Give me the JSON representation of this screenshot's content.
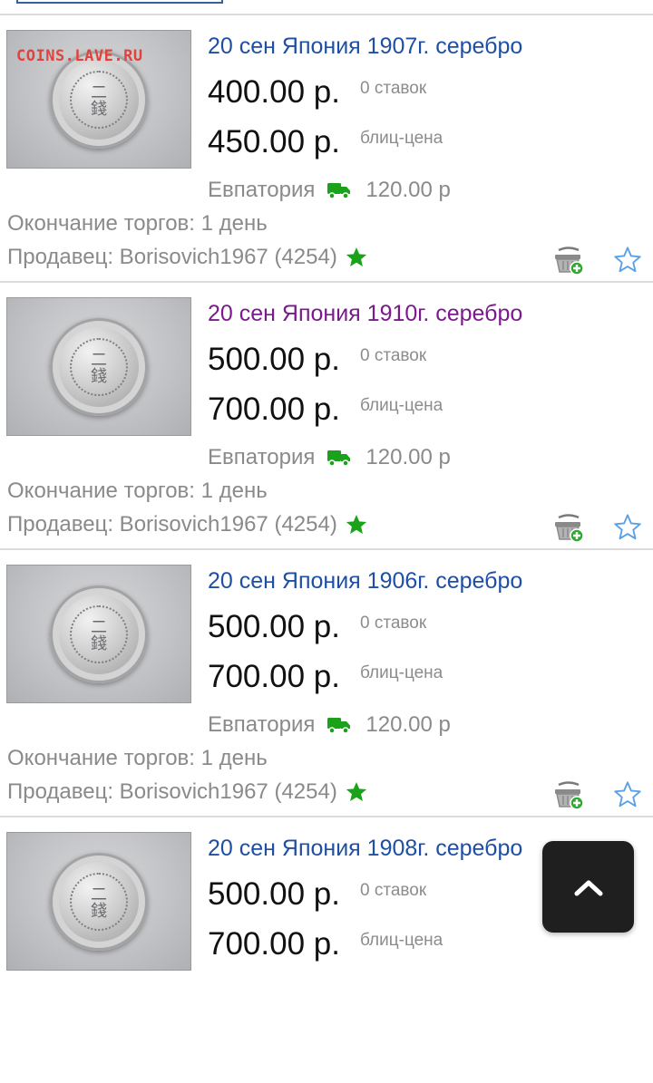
{
  "listings": [
    {
      "title": "20 сен Япония 1907г. серебро",
      "visited": false,
      "watermark": "COINS.LAVE.RU",
      "coin_glyph": "二\n錢",
      "current_price": "400.00 р.",
      "bids": "0 ставок",
      "buy_now_price": "450.00 р.",
      "buy_now_label": "блиц-цена",
      "location": "Евпатория",
      "shipping": "120.00 р",
      "ends": "Окончание торгов: 1 день",
      "seller": "Продавец: Borisovich1967 (4254)"
    },
    {
      "title": "20 сен Япония 1910г. серебро",
      "visited": true,
      "watermark": "",
      "coin_glyph": "二\n錢",
      "current_price": "500.00 р.",
      "bids": "0 ставок",
      "buy_now_price": "700.00 р.",
      "buy_now_label": "блиц-цена",
      "location": "Евпатория",
      "shipping": "120.00 р",
      "ends": "Окончание торгов: 1 день",
      "seller": "Продавец: Borisovich1967 (4254)"
    },
    {
      "title": "20 сен Япония 1906г. серебро",
      "visited": false,
      "watermark": "",
      "coin_glyph": "二\n錢",
      "current_price": "500.00 р.",
      "bids": "0 ставок",
      "buy_now_price": "700.00 р.",
      "buy_now_label": "блиц-цена",
      "location": "Евпатория",
      "shipping": "120.00 р",
      "ends": "Окончание торгов: 1 день",
      "seller": "Продавец: Borisovich1967 (4254)"
    },
    {
      "title": "20 сен Япония 1908г. серебро",
      "visited": false,
      "watermark": "",
      "coin_glyph": "二\n錢",
      "current_price": "500.00 р.",
      "bids": "0 ставок",
      "buy_now_price": "700.00 р.",
      "buy_now_label": "блиц-цена",
      "location": "",
      "shipping": "",
      "ends": "",
      "seller": ""
    }
  ],
  "icons": {
    "shipping": "truck-icon",
    "seller_rating": "green-star-icon",
    "add_to_basket": "basket-add-icon",
    "favorite": "star-outline-icon",
    "scroll_top": "chevron-up-icon"
  },
  "colors": {
    "link": "#1f4fa3",
    "visited_link": "#7b1a8c",
    "muted_text": "#8a8a8a",
    "green": "#1aa31a",
    "watermark": "#e0433d"
  }
}
